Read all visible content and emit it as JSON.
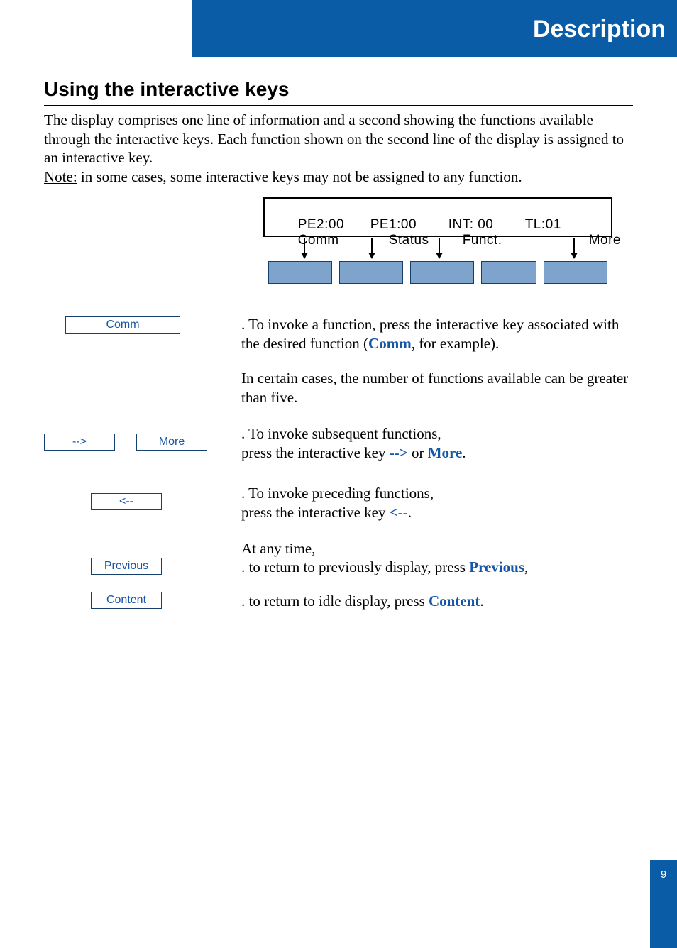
{
  "header": {
    "title": "Description"
  },
  "section": {
    "heading": "Using the interactive keys"
  },
  "intro": {
    "text_before_note": "The display comprises one line of information and a second showing the functions available through the interactive keys. Each function shown on the second line of the display is assigned to an interactive key.",
    "note_label": "Note:",
    "note_text": " in some cases, some interactive keys may not be assigned to any function."
  },
  "display": {
    "line1": {
      "c1": "PE2:00",
      "c2": "PE1:00",
      "c3": "INT: 00",
      "c4": "TL:01"
    },
    "line2": {
      "c1": "Comm",
      "c2": "Status",
      "c3": "Funct.",
      "c4": "More"
    }
  },
  "buttons": {
    "comm": "Comm",
    "next": "-->",
    "more": "More",
    "prev": "<--",
    "previous": "Previous",
    "content": "Content"
  },
  "para": {
    "p1a": ". To invoke a function, press the interactive key associated with the desired function (",
    "p1_hl": "Comm",
    "p1b": ", for example).",
    "p2": "In certain cases, the number of functions available can be greater than five.",
    "p3a": ". To invoke subsequent functions,",
    "p3b_pre": "press the interactive key ",
    "p3_hl1": "-->",
    "p3_mid": " or ",
    "p3_hl2": "More",
    "p3_end": ".",
    "p4a": ". To invoke preceding functions,",
    "p4b_pre": "press the interactive key ",
    "p4_hl": "<--",
    "p4_end": ".",
    "p5": "At any time,",
    "p6a": ". to return to previously display, press ",
    "p6_hl": "Previous",
    "p6b": ",",
    "p7a": ". to return to idle display, press ",
    "p7_hl": "Content",
    "p7b": "."
  },
  "page_number": "9"
}
